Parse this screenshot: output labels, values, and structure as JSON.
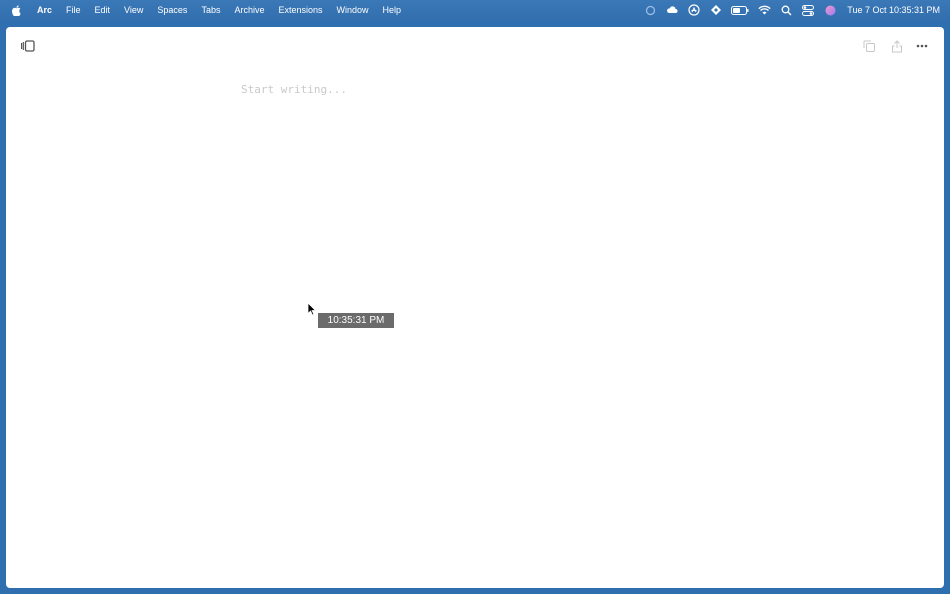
{
  "menubar": {
    "app_name": "Arc",
    "items": [
      "File",
      "Edit",
      "View",
      "Spaces",
      "Tabs",
      "Archive",
      "Extensions",
      "Window",
      "Help"
    ],
    "status_icons": [
      "sync-icon",
      "cloud-icon",
      "app-store-icon",
      "focus-icon",
      "battery-icon",
      "wifi-icon",
      "search-icon",
      "control-center-icon",
      "siri-icon"
    ],
    "clock": "Tue 7 Oct  10:35:31 PM"
  },
  "editor": {
    "placeholder": "Start writing..."
  },
  "tooltip": {
    "time": "10:35:31 PM"
  },
  "colors": {
    "menubar": "#3574b4",
    "window": "#ffffff",
    "placeholder": "#c9c9c9",
    "tooltip_bg": "#6b6b6b"
  }
}
